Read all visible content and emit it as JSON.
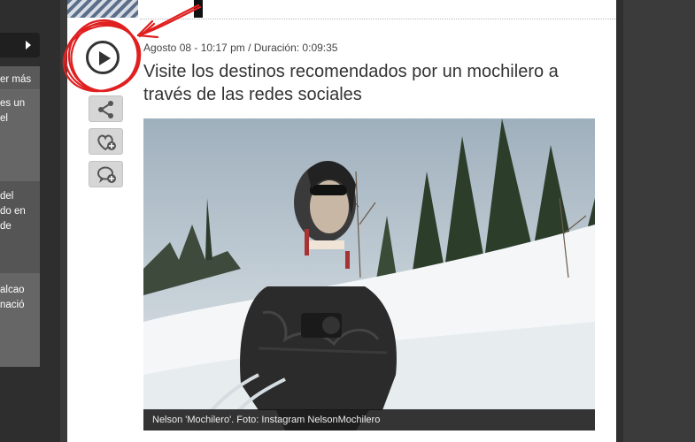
{
  "sidebar": {
    "items": [
      {
        "label": "er más"
      },
      {
        "label": "es un\nel"
      },
      {
        "label": "del\ndo en\nde"
      },
      {
        "label": "alcao\nnació"
      }
    ]
  },
  "article": {
    "meta": "Agosto 08 - 10:17 pm / Duración: 0:09:35",
    "title": "Visite los destinos recomendados por un mochilero a través de las redes sociales",
    "caption": "Nelson 'Mochilero'. Foto: Instagram NelsonMochilero"
  },
  "icons": {
    "play": "play-circle-icon",
    "share": "share-icon",
    "favorite": "heart-plus-icon",
    "comment": "comment-plus-icon"
  },
  "colors": {
    "annotation": "#e02020",
    "content_bg": "#ffffff",
    "page_bg": "#3a3a3a"
  }
}
